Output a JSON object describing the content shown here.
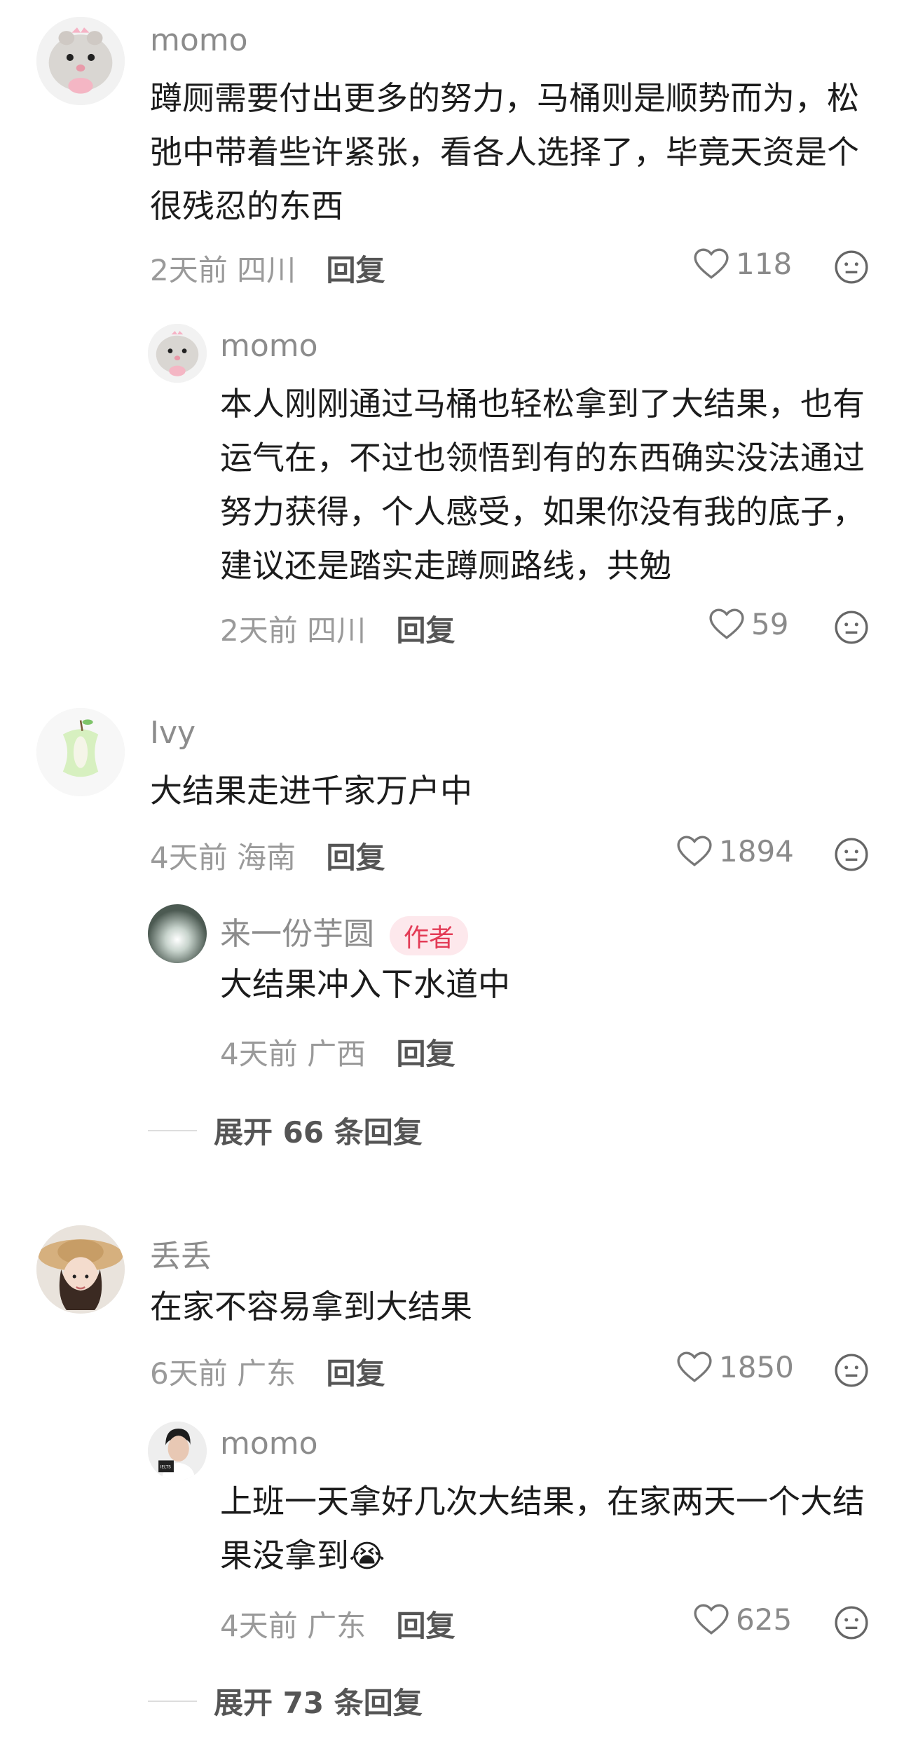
{
  "comments": [
    {
      "username": "momo",
      "text": "蹲厕需要付出更多的努力，马桶则是顺势而为，松弛中带着些许紧张，看各人选择了，毕竟天资是个很残忍的东西",
      "time": "2天前",
      "location": "四川",
      "reply_label": "回复",
      "likes": "118",
      "avatar": "hamster-avatar",
      "replies": [
        {
          "username": "momo",
          "text": "本人刚刚通过马桶也轻松拿到了大结果，也有运气在，不过也领悟到有的东西确实没法通过努力获得，个人感受，如果你没有我的底子，建议还是踏实走蹲厕路线，共勉",
          "time": "2天前",
          "location": "四川",
          "reply_label": "回复",
          "likes": "59"
        }
      ]
    },
    {
      "username": "Ivy",
      "text": "大结果走进千家万户中",
      "time": "4天前",
      "location": "海南",
      "reply_label": "回复",
      "likes": "1894",
      "replies": [
        {
          "username": "来一份芋圆",
          "badge": "作者",
          "text": "大结果冲入下水道中",
          "time": "4天前",
          "location": "广西",
          "reply_label": "回复"
        }
      ],
      "expand_label": "展开 66 条回复"
    },
    {
      "username": "丢丢",
      "text": "在家不容易拿到大结果",
      "time": "6天前",
      "location": "广东",
      "reply_label": "回复",
      "likes": "1850",
      "replies": [
        {
          "username": "momo",
          "text": "上班一天拿好几次大结果，在家两天一个大结果没拿到",
          "time": "4天前",
          "location": "广东",
          "reply_label": "回复",
          "likes": "625"
        }
      ],
      "expand_label": "展开 73 条回复"
    }
  ],
  "icons": {
    "like": "heart-outline-icon",
    "more": "neutral-face-icon"
  },
  "colors": {
    "author_badge_bg": "#fde8ec",
    "author_badge_text": "#e33b56",
    "meta_text": "#9a9a9a"
  }
}
